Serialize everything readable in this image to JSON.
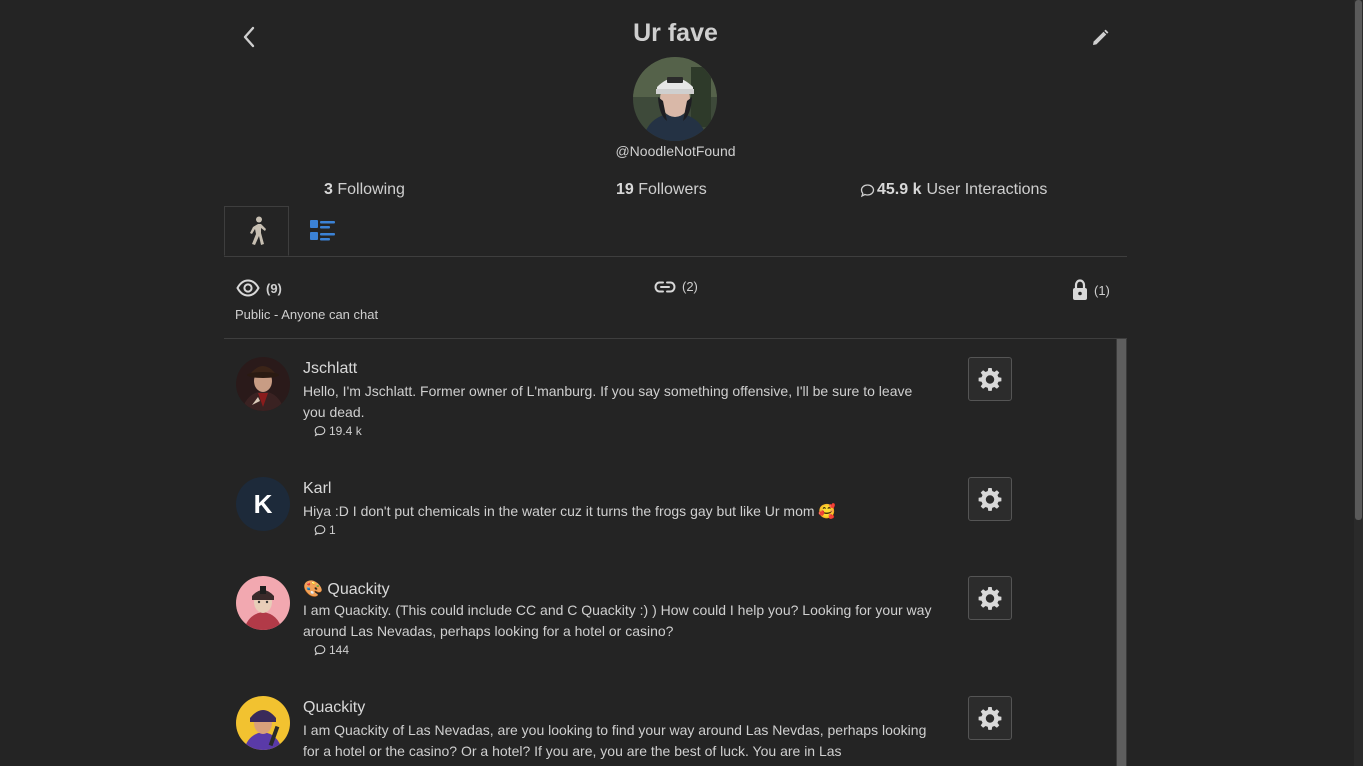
{
  "header": {
    "title": "Ur fave",
    "handle": "@NoodleNotFound"
  },
  "stats": {
    "following_count": "3",
    "following_label": "Following",
    "followers_count": "19",
    "followers_label": "Followers",
    "interactions_count": "45.9 k",
    "interactions_label": "User Interactions"
  },
  "tabs": [
    {
      "icon": "character-icon",
      "active": true
    },
    {
      "icon": "list-icon",
      "active": false
    }
  ],
  "filters": {
    "public_count": "(9)",
    "link_count": "(2)",
    "private_count": "(1)",
    "visibility_label": "Public - Anyone can chat"
  },
  "characters": [
    {
      "name": "Jschlatt",
      "description": "Hello, I'm Jschlatt. Former owner of L'manburg. If you say something offensive, I'll be sure to leave you dead.",
      "count": "19.4 k"
    },
    {
      "name": "Karl",
      "avatar_letter": "K",
      "description": "Hiya :D I don't put chemicals in the water cuz it turns the frogs gay but like Ur mom 🥰",
      "count": "1"
    },
    {
      "name": "🎨 Quackity",
      "description": "I am Quackity. (This could include CC and C Quackity :) ) How could I help you? Looking for your way around Las Nevadas, perhaps looking for a hotel or casino?",
      "count": "144"
    },
    {
      "name": "Quackity",
      "description": "I am Quackity of Las Nevadas, are you looking to find your way around Las Nevdas, perhaps looking for a hotel or the casino? Or a hotel? If you are, you are the best of luck. You are in Las",
      "count": ""
    }
  ],
  "colors": {
    "background": "#242424",
    "text": "#d6d6d6",
    "accent_blue": "#3b82d6",
    "border": "#3e3e3e"
  }
}
